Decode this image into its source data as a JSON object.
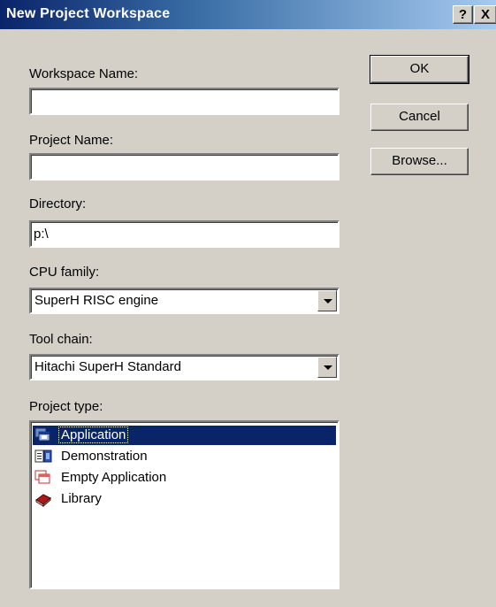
{
  "window": {
    "title": "New Project Workspace",
    "help_label": "?",
    "close_label": "X"
  },
  "buttons": {
    "ok": "OK",
    "cancel": "Cancel",
    "browse": "Browse..."
  },
  "workspace_name": {
    "label": "Workspace Name:",
    "value": ""
  },
  "project_name": {
    "label": "Project Name:",
    "value": ""
  },
  "directory": {
    "label": "Directory:",
    "value": "p:\\"
  },
  "cpu_family": {
    "label": "CPU family:",
    "selected": "SuperH RISC engine"
  },
  "tool_chain": {
    "label": "Tool chain:",
    "selected": "Hitachi SuperH Standard"
  },
  "project_type": {
    "label": "Project type:",
    "items": [
      {
        "label": "Application",
        "icon": "application-icon",
        "selected": true
      },
      {
        "label": "Demonstration",
        "icon": "demonstration-icon",
        "selected": false
      },
      {
        "label": "Empty Application",
        "icon": "empty-application-icon",
        "selected": false
      },
      {
        "label": "Library",
        "icon": "library-icon",
        "selected": false
      }
    ]
  },
  "colors": {
    "title_start": "#0a246a",
    "title_end": "#a6caf0",
    "dialog_bg": "#d4d0c8",
    "selection": "#0a246a"
  }
}
